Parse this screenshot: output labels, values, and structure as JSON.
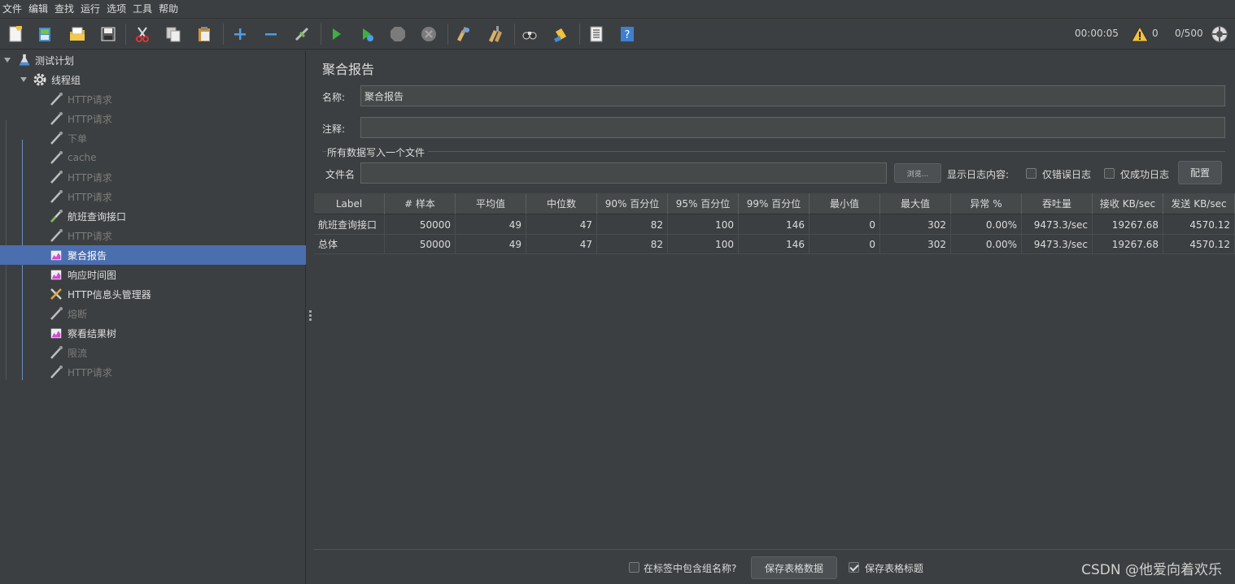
{
  "menu": [
    "文件",
    "编辑",
    "查找",
    "运行",
    "选项",
    "工具",
    "帮助"
  ],
  "toolbar": {
    "timer": "00:00:05",
    "warning_count": "0",
    "threads": "0/500",
    "icons": [
      "new-icon",
      "templates-icon",
      "open-icon",
      "save-icon",
      "cut-icon",
      "copy-icon",
      "paste-icon",
      "expand-icon",
      "collapse-icon",
      "toggle-icon",
      "start-icon",
      "start-no-pause-icon",
      "stop-icon",
      "shutdown-icon",
      "clear-icon",
      "clear-all-icon",
      "search-icon",
      "reset-search-icon",
      "function-helper-icon",
      "help-icon"
    ]
  },
  "tree": {
    "root": "测试计划",
    "thread_group": "线程组",
    "items": [
      {
        "label": "HTTP请求",
        "enabled": false,
        "icon": "pipette-icon"
      },
      {
        "label": "HTTP请求",
        "enabled": false,
        "icon": "pipette-icon"
      },
      {
        "label": "下单",
        "enabled": false,
        "icon": "pipette-icon"
      },
      {
        "label": "cache",
        "enabled": false,
        "icon": "pipette-icon"
      },
      {
        "label": "HTTP请求",
        "enabled": false,
        "icon": "pipette-icon"
      },
      {
        "label": "HTTP请求",
        "enabled": false,
        "icon": "pipette-icon"
      },
      {
        "label": "航班查询接口",
        "enabled": true,
        "icon": "pipette-icon"
      },
      {
        "label": "HTTP请求",
        "enabled": false,
        "icon": "pipette-icon"
      },
      {
        "label": "聚合报告",
        "enabled": true,
        "icon": "graph-icon",
        "selected": true
      },
      {
        "label": "响应时间图",
        "enabled": true,
        "icon": "graph-icon"
      },
      {
        "label": "HTTP信息头管理器",
        "enabled": true,
        "icon": "wrench-icon"
      },
      {
        "label": "熔断",
        "enabled": false,
        "icon": "pipette-icon"
      },
      {
        "label": "察看结果树",
        "enabled": true,
        "icon": "graph-icon"
      },
      {
        "label": "限流",
        "enabled": false,
        "icon": "pipette-icon"
      },
      {
        "label": "HTTP请求",
        "enabled": false,
        "icon": "pipette-icon"
      }
    ]
  },
  "panel": {
    "title": "聚合报告",
    "name_label": "名称:",
    "name_value": "聚合报告",
    "comment_label": "注释:",
    "comment_value": "",
    "file_group_title": "所有数据写入一个文件",
    "file_label": "文件名",
    "file_value": "",
    "browse_button": "浏览...",
    "log_content_label": "显示日志内容:",
    "errors_only_label": "仅错误日志",
    "success_only_label": "仅成功日志",
    "configure_button": "配置"
  },
  "table": {
    "columns": [
      "Label",
      "# 样本",
      "平均值",
      "中位数",
      "90% 百分位",
      "95% 百分位",
      "99% 百分位",
      "最小值",
      "最大值",
      "异常 %",
      "吞吐量",
      "接收 KB/sec",
      "发送 KB/sec"
    ],
    "rows": [
      [
        "航班查询接口",
        "50000",
        "49",
        "47",
        "82",
        "100",
        "146",
        "0",
        "302",
        "0.00%",
        "9473.3/sec",
        "19267.68",
        "4570.12"
      ],
      [
        "总体",
        "50000",
        "49",
        "47",
        "82",
        "100",
        "146",
        "0",
        "302",
        "0.00%",
        "9473.3/sec",
        "19267.68",
        "4570.12"
      ]
    ]
  },
  "bottom": {
    "include_group_label": "在标签中包含组名称?",
    "save_table_button": "保存表格数据",
    "save_header_label": "保存表格标题",
    "save_header_checked": true
  },
  "watermark": "CSDN @他爱向着欢乐"
}
